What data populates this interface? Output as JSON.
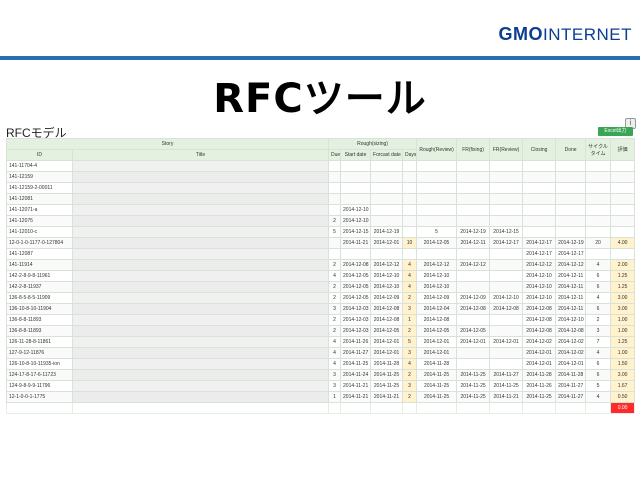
{
  "brand": {
    "logo_gmo": "GMO",
    "logo_internet": "INTERNET"
  },
  "slide": {
    "title": "RFCツール"
  },
  "section": {
    "title": "RFCモデル",
    "export_button": "Excel出力"
  },
  "table": {
    "group_headers": {
      "story": "Story",
      "rough_sizing": "Rough(sizing)"
    },
    "columns": [
      "ID",
      "Title",
      "Due",
      "Start date",
      "Forcast date",
      "Days",
      "Rough(Review)",
      "FR(fixing)",
      "FR(Review)",
      "Closing",
      "Done",
      "サイクルタイム",
      "評価"
    ],
    "rows": [
      [
        "141-11704-4",
        "",
        "",
        "",
        "",
        "",
        "",
        "",
        "",
        "",
        "",
        "",
        ""
      ],
      [
        "141-12159",
        "",
        "",
        "",
        "",
        "",
        "",
        "",
        "",
        "",
        "",
        "",
        ""
      ],
      [
        "141-12159-2-00011",
        "",
        "",
        "",
        "",
        "",
        "",
        "",
        "",
        "",
        "",
        "",
        ""
      ],
      [
        "141-12081",
        "",
        "",
        "",
        "",
        "",
        "",
        "",
        "",
        "",
        "",
        "",
        ""
      ],
      [
        "141-12071-a",
        "",
        "",
        "2014-12-10",
        "",
        "",
        "",
        "",
        "",
        "",
        "",
        "",
        ""
      ],
      [
        "141-12075",
        "",
        "2",
        "2014-12-10",
        "",
        "",
        "",
        "",
        "",
        "",
        "",
        "",
        ""
      ],
      [
        "141-12010-c",
        "",
        "5",
        "2014-12-15",
        "2014-12-19",
        "",
        "5",
        "2014-12-19",
        "2014-12-15",
        "",
        "",
        "",
        ""
      ],
      [
        "12-0-1-0-1177-0-127804",
        "",
        "",
        "2014-11-21",
        "2014-12-01",
        "10",
        "2014-12-05",
        "2014-12-11",
        "2014-12-17",
        "2014-12-17",
        "2014-12-19",
        "20",
        "4.00"
      ],
      [
        "141-12087",
        "",
        "",
        "",
        "",
        "",
        "",
        "",
        "",
        "2014-12-17",
        "2014-12-17",
        "",
        ""
      ],
      [
        "141-11914",
        "",
        "2",
        "2014-12-08",
        "2014-12-12",
        "4",
        "2014-12-12",
        "2014-12-12",
        "",
        "2014-12-12",
        "2014-12-12",
        "4",
        "2.00"
      ],
      [
        "142-2-8-9-8-11961",
        "",
        "4",
        "2014-12-05",
        "2014-12-10",
        "4",
        "2014-12-10",
        "",
        "",
        "2014-12-10",
        "2014-12-11",
        "6",
        "1.25"
      ],
      [
        "142-2-8-11937",
        "",
        "2",
        "2014-12-05",
        "2014-12-10",
        "4",
        "2014-12-10",
        "",
        "",
        "2014-12-10",
        "2014-12-11",
        "6",
        "1.25"
      ],
      [
        "136-8-5-8-5-11909",
        "",
        "2",
        "2014-12-05",
        "2014-12-09",
        "2",
        "2014-12-09",
        "2014-12-09",
        "2014-12-10",
        "2014-12-10",
        "2014-12-11",
        "4",
        "3.00"
      ],
      [
        "136-10-8-10-11904",
        "",
        "3",
        "2014-12-03",
        "2014-12-08",
        "3",
        "2014-12-04",
        "2014-12-08",
        "2014-12-08",
        "2014-12-08",
        "2014-12-11",
        "6",
        "3.00"
      ],
      [
        "136-8-8-11893",
        "",
        "2",
        "2014-12-03",
        "2014-12-08",
        "1",
        "2014-12-08",
        "",
        "",
        "2014-12-08",
        "2014-12-10",
        "2",
        "1.00"
      ],
      [
        "136-8-8-11893",
        "",
        "2",
        "2014-12-03",
        "2014-12-05",
        "2",
        "2014-12-05",
        "2014-12-05",
        "",
        "2014-12-08",
        "2014-12-08",
        "3",
        "1.00"
      ],
      [
        "126-11-28-8-11861",
        "",
        "4",
        "2014-11-26",
        "2014-12-01",
        "5",
        "2014-12-01",
        "2014-12-01",
        "2014-12-01",
        "2014-12-02",
        "2014-12-02",
        "7",
        "1.25"
      ],
      [
        "127-9-12-11876",
        "",
        "4",
        "2014-11-27",
        "2014-12-01",
        "3",
        "2014-12-01",
        "",
        "",
        "2014-12-01",
        "2014-12-02",
        "4",
        "1.00"
      ],
      [
        "126-10-8-10-11935-ion",
        "",
        "4",
        "2014-11-25",
        "2014-11-28",
        "4",
        "2014-11-28",
        "",
        "",
        "2014-12-01",
        "2014-12-01",
        "6",
        "1.50"
      ],
      [
        "124-17-8-17-6-11723",
        "",
        "3",
        "2014-11-24",
        "2014-11-25",
        "2",
        "2014-11-25",
        "2014-11-25",
        "2014-11-27",
        "2014-11-28",
        "2014-11-28",
        "6",
        "3.00"
      ],
      [
        "124-9-8-9-9-11796",
        "",
        "3",
        "2014-11-21",
        "2014-11-25",
        "3",
        "2014-11-25",
        "2014-11-25",
        "2014-11-25",
        "2014-11-26",
        "2014-11-27",
        "5",
        "1.67"
      ],
      [
        "12-1-0-0-1-1775",
        "",
        "1",
        "2014-11-21",
        "2014-11-21",
        "2",
        "2014-11-25",
        "2014-11-25",
        "2014-11-21",
        "2014-11-25",
        "2014-11-27",
        "4",
        "0.50"
      ]
    ],
    "footer_value": "0.00"
  }
}
